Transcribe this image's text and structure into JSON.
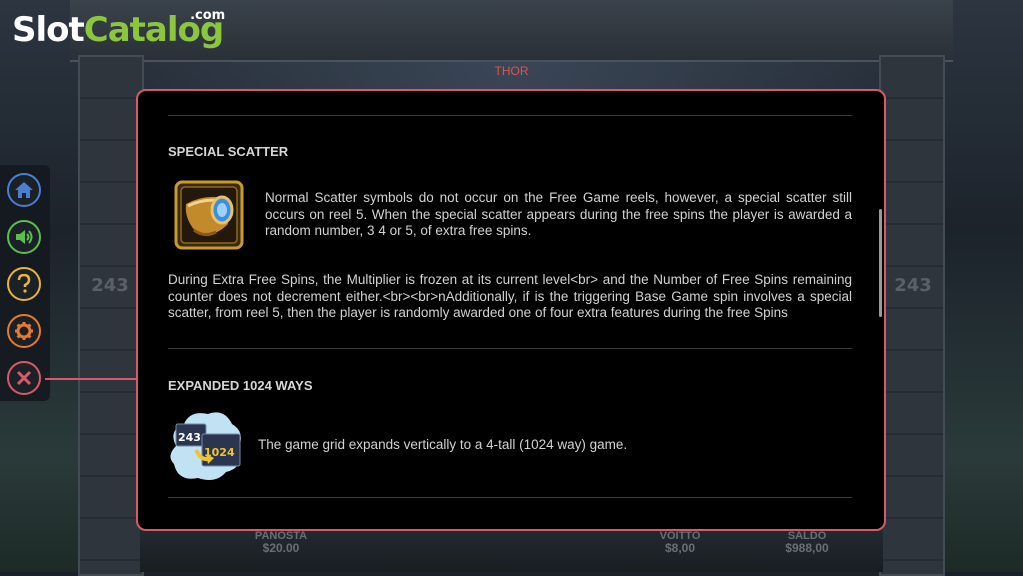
{
  "logo": {
    "slot": "Slot",
    "catalog": "Catalog",
    "com": ".com"
  },
  "game": {
    "title": "THOR"
  },
  "background": {
    "ways_left": "243",
    "ways_right": "243",
    "stats": [
      {
        "label": "PANOSTA",
        "value": "$20.00"
      },
      {
        "label": "VOITTO",
        "value": "$8,00"
      },
      {
        "label": "SALDO",
        "value": "$988,00"
      }
    ]
  },
  "side_menu": [
    {
      "name": "home-icon",
      "color": "#4a7fd0"
    },
    {
      "name": "sound-icon",
      "color": "#5cbf4d"
    },
    {
      "name": "help-icon",
      "color": "#e8b53a"
    },
    {
      "name": "settings-icon",
      "color": "#e87a2c"
    },
    {
      "name": "close-icon",
      "color": "#d9596a"
    }
  ],
  "sections": {
    "special_scatter": {
      "title": "SPECIAL SCATTER",
      "icon": "horn-scatter-icon",
      "text1": "Normal Scatter symbols do not occur on the Free Game reels, however, a special scatter still occurs on reel 5. When the special scatter appears during the free spins the player is awarded a random number, 3 4 or 5, of extra free spins.",
      "text2": "During Extra Free Spins, the Multiplier is frozen at its current level<br> and the Number of Free Spins remaining counter does not decrement either.<br><br>nAdditionally, if is the triggering Base Game spin involves a special scatter, from reel 5, then the player is randomly awarded one of four extra features during the free Spins"
    },
    "expanded_ways": {
      "title": "EXPANDED 1024 WAYS",
      "icon": "expanded-ways-icon",
      "badge_from": "243",
      "badge_to": "1024",
      "text": "The game grid expands vertically to a 4-tall (1024 way) game."
    }
  },
  "colors": {
    "accent": "#d9596a",
    "title_red": "#e0524f",
    "logo_green": "#8cc63f"
  }
}
